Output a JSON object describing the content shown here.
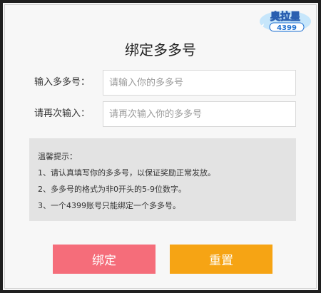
{
  "logo_text": "奥拉星 4399",
  "title": "绑定多多号",
  "form": {
    "account_label": "输入多多号：",
    "account_placeholder": "请输入你的多多号",
    "confirm_label": "请再次输入：",
    "confirm_placeholder": "请再次输入你的多多号"
  },
  "tips": {
    "heading": "温馨提示：",
    "items": [
      "1、请认真填写你的多多号，以保证奖励正常发放。",
      "2、多多号的格式为非0开头的5-9位数字。",
      "3、一个4399账号只能绑定一个多多号。"
    ]
  },
  "buttons": {
    "bind": "绑定",
    "reset": "重置"
  },
  "colors": {
    "bind_button": "#f56d7a",
    "reset_button": "#f6a414",
    "tips_background": "#e3e3e3"
  }
}
